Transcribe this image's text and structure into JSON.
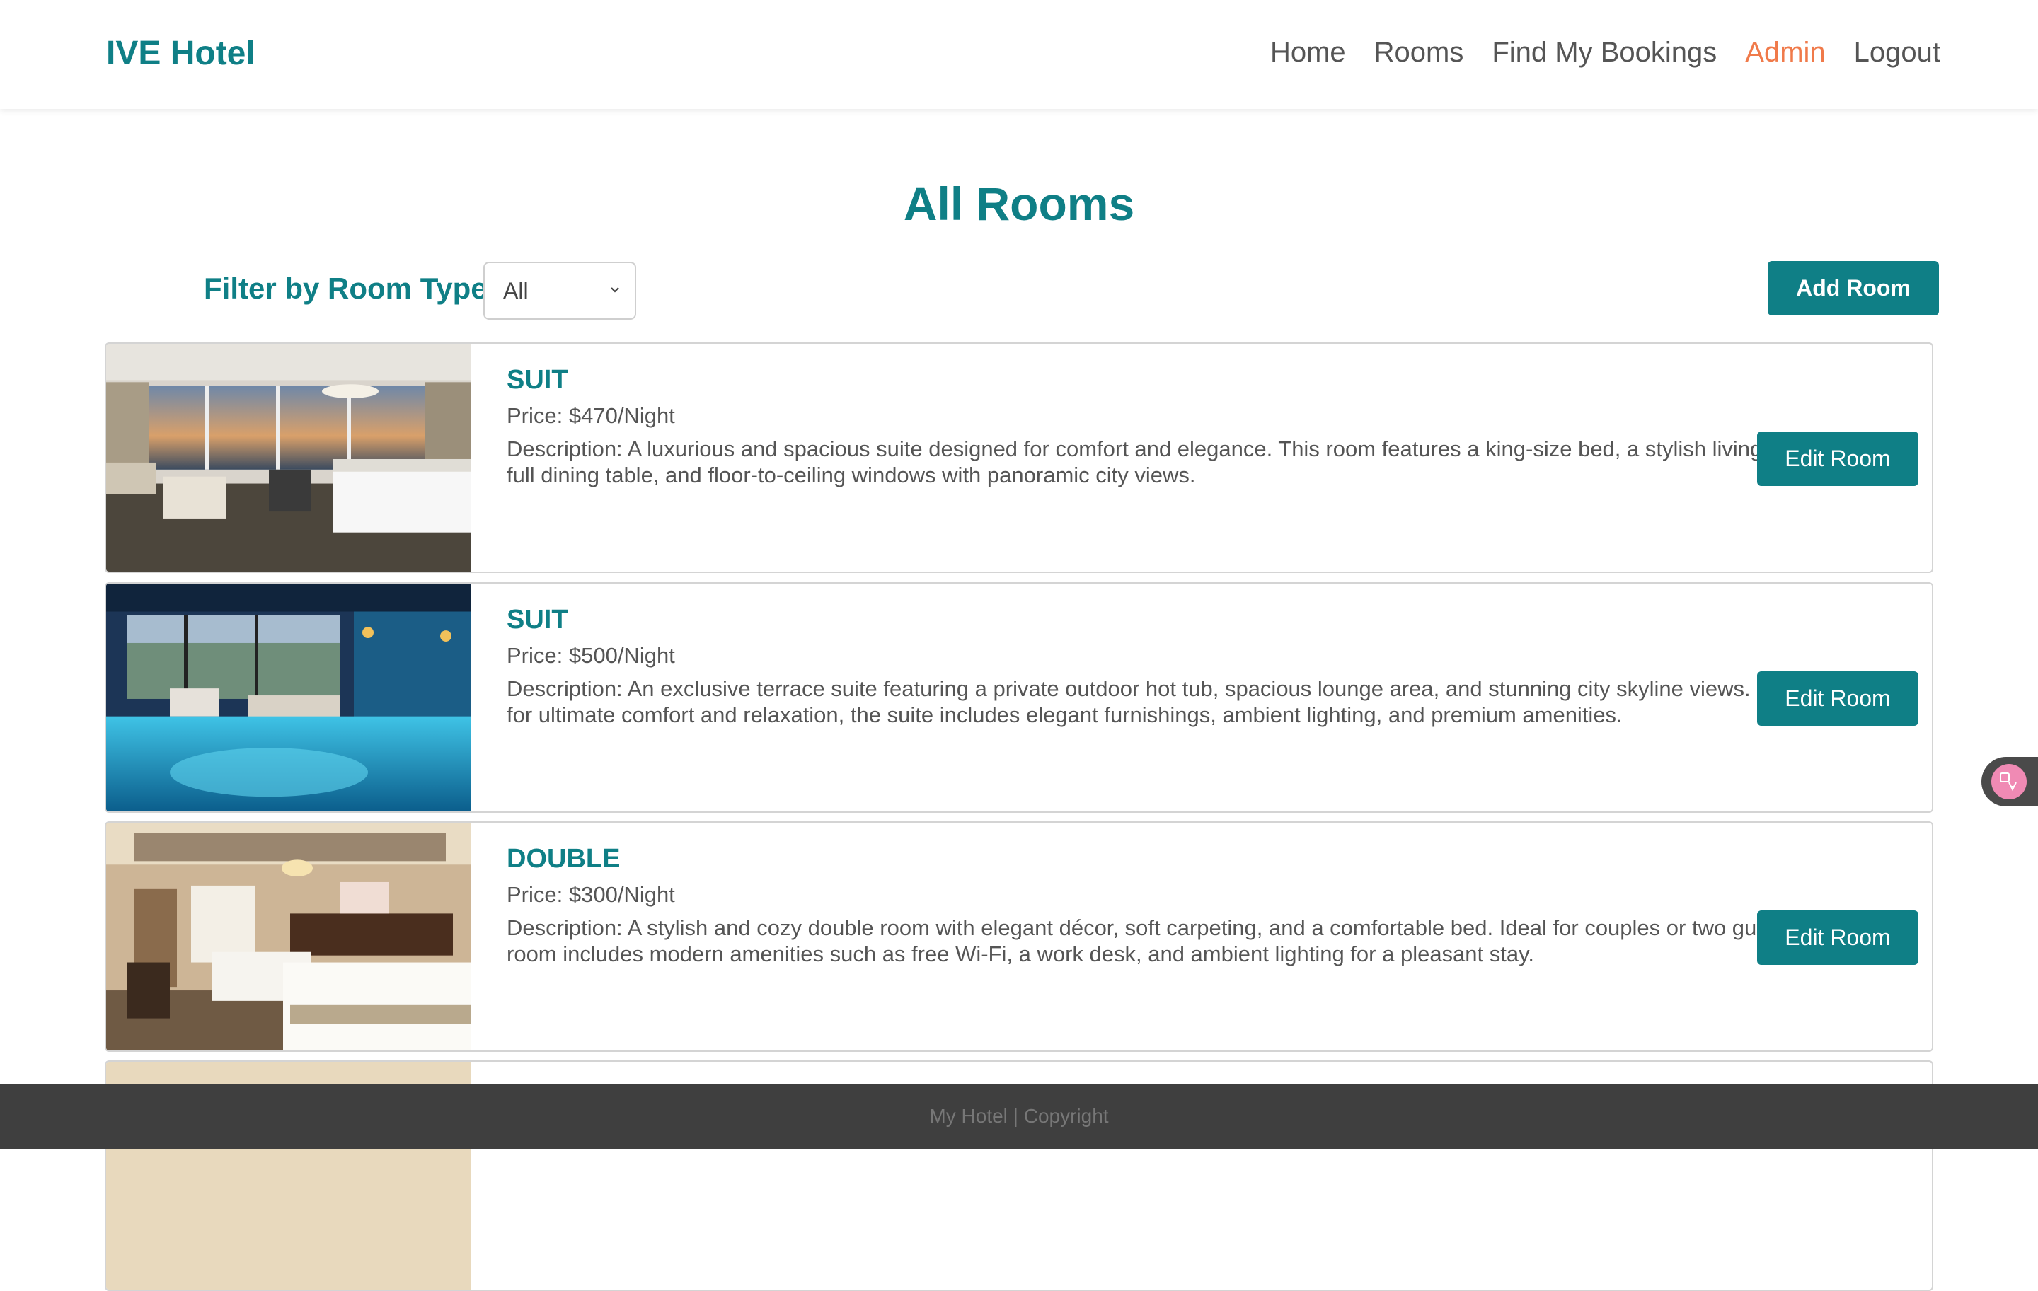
{
  "brand": "IVE Hotel",
  "nav": {
    "home": "Home",
    "rooms": "Rooms",
    "find_bookings": "Find My Bookings",
    "admin": "Admin",
    "logout": "Logout"
  },
  "page_title": "All Rooms",
  "filter": {
    "label": "Filter by Room Type:",
    "selected": "All"
  },
  "add_room_label": "Add Room",
  "rooms": [
    {
      "type": "SUIT",
      "price": "Price: $470/Night",
      "description": "Description: A luxurious and spacious suite designed for comfort and elegance. This room features a king-size bed, a stylish living area, a full dining table, and floor-to-ceiling windows with panoramic city views.",
      "edit_label": "Edit Room"
    },
    {
      "type": "SUIT",
      "price": "Price: $500/Night",
      "description": "Description: An exclusive terrace suite featuring a private outdoor hot tub, spacious lounge area, and stunning city skyline views. Designed for ultimate comfort and relaxation, the suite includes elegant furnishings, ambient lighting, and premium amenities.",
      "edit_label": "Edit Room"
    },
    {
      "type": "DOUBLE",
      "price": "Price: $300/Night",
      "description": "Description: A stylish and cozy double room with elegant décor, soft carpeting, and a comfortable bed. Ideal for couples or two guests. The room includes modern amenities such as free Wi-Fi, a work desk, and ambient lighting for a pleasant stay.",
      "edit_label": "Edit Room"
    }
  ],
  "footer_text": "My Hotel | Copyright",
  "colors": {
    "brand": "#0f7f86",
    "active_nav": "#f07a4a",
    "footer_bg": "#3f3f3f"
  }
}
